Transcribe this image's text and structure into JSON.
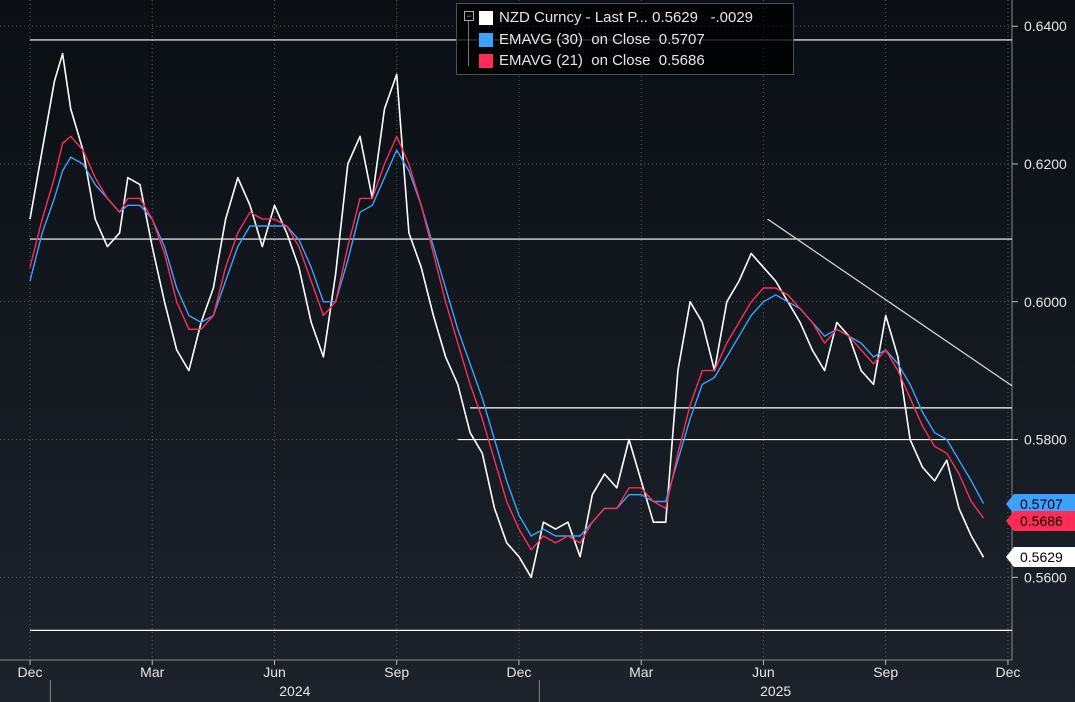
{
  "legend": {
    "rows": [
      {
        "text": "NZD Curncy - Last P... 0.5629   -.0029",
        "color": "#ffffff"
      },
      {
        "text": "EMAVG (30)  on Close  0.5707",
        "color": "#3ea0ff"
      },
      {
        "text": "EMAVG (21)  on Close  0.5686",
        "color": "#ff2d55"
      }
    ]
  },
  "tags": [
    {
      "text": "0.5707",
      "bg": "#3ea0ff",
      "fg": "#000000",
      "value": 0.5707
    },
    {
      "text": "0.5686",
      "bg": "#ff2d55",
      "fg": "#000000",
      "value": 0.5686
    },
    {
      "text": "0.5629",
      "bg": "#ffffff",
      "fg": "#000000",
      "value": 0.5629
    }
  ],
  "chart_data": {
    "type": "line",
    "ylim": [
      0.548,
      0.6438
    ],
    "yticks": [
      {
        "value": 0.64,
        "label": "0.6400"
      },
      {
        "value": 0.62,
        "label": "0.6200"
      },
      {
        "value": 0.6,
        "label": "0.6000"
      },
      {
        "value": 0.58,
        "label": "0.5800"
      },
      {
        "value": 0.56,
        "label": "0.5600"
      }
    ],
    "xlim": [
      0,
      24.1
    ],
    "xticks": [
      {
        "value": 0,
        "label": "Dec"
      },
      {
        "value": 3,
        "label": "Mar"
      },
      {
        "value": 6,
        "label": "Jun"
      },
      {
        "value": 9,
        "label": "Sep"
      },
      {
        "value": 12,
        "label": "Dec"
      },
      {
        "value": 15,
        "label": "Mar"
      },
      {
        "value": 18,
        "label": "Jun"
      },
      {
        "value": 21,
        "label": "Sep"
      },
      {
        "value": 24,
        "label": "Dec"
      }
    ],
    "years": [
      {
        "label": "2024",
        "from": 0.5,
        "to": 12.5
      },
      {
        "label": "2025",
        "from": 12.5,
        "to": 24.1
      }
    ],
    "year_dividers": [
      0.5,
      12.5
    ],
    "series": [
      {
        "name": "NZD Curncy - Last Price",
        "color": "#ffffff",
        "x": [
          0,
          0.3,
          0.6,
          0.8,
          1.0,
          1.3,
          1.6,
          1.9,
          2.2,
          2.4,
          2.7,
          3.0,
          3.3,
          3.6,
          3.9,
          4.2,
          4.5,
          4.8,
          5.1,
          5.4,
          5.7,
          6.0,
          6.3,
          6.6,
          6.9,
          7.2,
          7.5,
          7.8,
          8.1,
          8.4,
          8.7,
          9.0,
          9.3,
          9.6,
          9.9,
          10.2,
          10.5,
          10.8,
          11.1,
          11.4,
          11.7,
          12.0,
          12.3,
          12.6,
          12.9,
          13.2,
          13.5,
          13.8,
          14.1,
          14.4,
          14.7,
          15.0,
          15.3,
          15.6,
          15.9,
          16.2,
          16.5,
          16.8,
          17.1,
          17.4,
          17.7,
          18.0,
          18.3,
          18.6,
          18.9,
          19.2,
          19.5,
          19.8,
          20.1,
          20.4,
          20.7,
          21.0,
          21.3,
          21.6,
          21.9,
          22.2,
          22.5,
          22.8,
          23.1,
          23.4
        ],
        "y": [
          0.612,
          0.622,
          0.632,
          0.636,
          0.628,
          0.622,
          0.612,
          0.608,
          0.61,
          0.618,
          0.617,
          0.608,
          0.6,
          0.593,
          0.59,
          0.597,
          0.602,
          0.612,
          0.618,
          0.614,
          0.608,
          0.614,
          0.61,
          0.605,
          0.597,
          0.592,
          0.604,
          0.62,
          0.624,
          0.615,
          0.628,
          0.633,
          0.61,
          0.605,
          0.598,
          0.592,
          0.588,
          0.581,
          0.578,
          0.57,
          0.565,
          0.563,
          0.56,
          0.568,
          0.567,
          0.568,
          0.563,
          0.572,
          0.575,
          0.573,
          0.58,
          0.574,
          0.568,
          0.568,
          0.59,
          0.6,
          0.597,
          0.59,
          0.6,
          0.603,
          0.607,
          0.605,
          0.603,
          0.6,
          0.597,
          0.593,
          0.59,
          0.597,
          0.595,
          0.59,
          0.588,
          0.598,
          0.592,
          0.58,
          0.576,
          0.574,
          0.577,
          0.57,
          0.566,
          0.5629
        ]
      },
      {
        "name": "EMAVG (30) on Close",
        "color": "#3ea0ff",
        "x": [
          0,
          0.3,
          0.6,
          0.8,
          1.0,
          1.3,
          1.6,
          1.9,
          2.2,
          2.4,
          2.7,
          3.0,
          3.3,
          3.6,
          3.9,
          4.2,
          4.5,
          4.8,
          5.1,
          5.4,
          5.7,
          6.0,
          6.3,
          6.6,
          6.9,
          7.2,
          7.5,
          7.8,
          8.1,
          8.4,
          8.7,
          9.0,
          9.3,
          9.6,
          9.9,
          10.2,
          10.5,
          10.8,
          11.1,
          11.4,
          11.7,
          12.0,
          12.3,
          12.6,
          12.9,
          13.2,
          13.5,
          13.8,
          14.1,
          14.4,
          14.7,
          15.0,
          15.3,
          15.6,
          15.9,
          16.2,
          16.5,
          16.8,
          17.1,
          17.4,
          17.7,
          18.0,
          18.3,
          18.6,
          18.9,
          19.2,
          19.5,
          19.8,
          20.1,
          20.4,
          20.7,
          21.0,
          21.3,
          21.6,
          21.9,
          22.2,
          22.5,
          22.8,
          23.1,
          23.4
        ],
        "y": [
          0.603,
          0.61,
          0.615,
          0.619,
          0.621,
          0.62,
          0.617,
          0.615,
          0.613,
          0.614,
          0.614,
          0.612,
          0.608,
          0.602,
          0.598,
          0.597,
          0.598,
          0.603,
          0.608,
          0.611,
          0.611,
          0.611,
          0.611,
          0.609,
          0.605,
          0.6,
          0.6,
          0.606,
          0.613,
          0.614,
          0.618,
          0.622,
          0.619,
          0.614,
          0.608,
          0.602,
          0.596,
          0.591,
          0.586,
          0.58,
          0.574,
          0.569,
          0.566,
          0.567,
          0.566,
          0.566,
          0.566,
          0.568,
          0.57,
          0.57,
          0.572,
          0.572,
          0.571,
          0.571,
          0.577,
          0.583,
          0.588,
          0.589,
          0.592,
          0.595,
          0.598,
          0.6,
          0.601,
          0.6,
          0.599,
          0.597,
          0.595,
          0.596,
          0.595,
          0.594,
          0.592,
          0.593,
          0.591,
          0.588,
          0.584,
          0.581,
          0.58,
          0.577,
          0.574,
          0.5707
        ]
      },
      {
        "name": "EMAVG (21) on Close",
        "color": "#ff2d55",
        "x": [
          0,
          0.3,
          0.6,
          0.8,
          1.0,
          1.3,
          1.6,
          1.9,
          2.2,
          2.4,
          2.7,
          3.0,
          3.3,
          3.6,
          3.9,
          4.2,
          4.5,
          4.8,
          5.1,
          5.4,
          5.7,
          6.0,
          6.3,
          6.6,
          6.9,
          7.2,
          7.5,
          7.8,
          8.1,
          8.4,
          8.7,
          9.0,
          9.3,
          9.6,
          9.9,
          10.2,
          10.5,
          10.8,
          11.1,
          11.4,
          11.7,
          12.0,
          12.3,
          12.6,
          12.9,
          13.2,
          13.5,
          13.8,
          14.1,
          14.4,
          14.7,
          15.0,
          15.3,
          15.6,
          15.9,
          16.2,
          16.5,
          16.8,
          17.1,
          17.4,
          17.7,
          18.0,
          18.3,
          18.6,
          18.9,
          19.2,
          19.5,
          19.8,
          20.1,
          20.4,
          20.7,
          21.0,
          21.3,
          21.6,
          21.9,
          22.2,
          22.5,
          22.8,
          23.1,
          23.4
        ],
        "y": [
          0.605,
          0.612,
          0.618,
          0.623,
          0.624,
          0.622,
          0.618,
          0.615,
          0.613,
          0.615,
          0.615,
          0.612,
          0.607,
          0.6,
          0.596,
          0.596,
          0.598,
          0.605,
          0.61,
          0.613,
          0.612,
          0.612,
          0.611,
          0.608,
          0.603,
          0.598,
          0.6,
          0.608,
          0.615,
          0.615,
          0.62,
          0.624,
          0.62,
          0.614,
          0.607,
          0.6,
          0.594,
          0.588,
          0.583,
          0.577,
          0.571,
          0.567,
          0.564,
          0.566,
          0.565,
          0.566,
          0.565,
          0.568,
          0.57,
          0.57,
          0.573,
          0.573,
          0.571,
          0.57,
          0.578,
          0.585,
          0.59,
          0.59,
          0.594,
          0.597,
          0.6,
          0.602,
          0.602,
          0.601,
          0.599,
          0.597,
          0.594,
          0.596,
          0.595,
          0.593,
          0.591,
          0.593,
          0.59,
          0.586,
          0.582,
          0.579,
          0.578,
          0.575,
          0.571,
          0.5686
        ]
      }
    ],
    "hlines": [
      {
        "value": 0.638,
        "from": 0,
        "to": 24.1
      },
      {
        "value": 0.6091,
        "from": 0,
        "to": 24.1
      },
      {
        "value": 0.5846,
        "from": 10.8,
        "to": 24.1
      },
      {
        "value": 0.58,
        "from": 10.5,
        "to": 24.1
      },
      {
        "value": 0.5523,
        "from": 0,
        "to": 24.1
      }
    ],
    "trendlines": [
      {
        "from": [
          18.1,
          0.612
        ],
        "to": [
          24.1,
          0.5878
        ]
      }
    ]
  }
}
